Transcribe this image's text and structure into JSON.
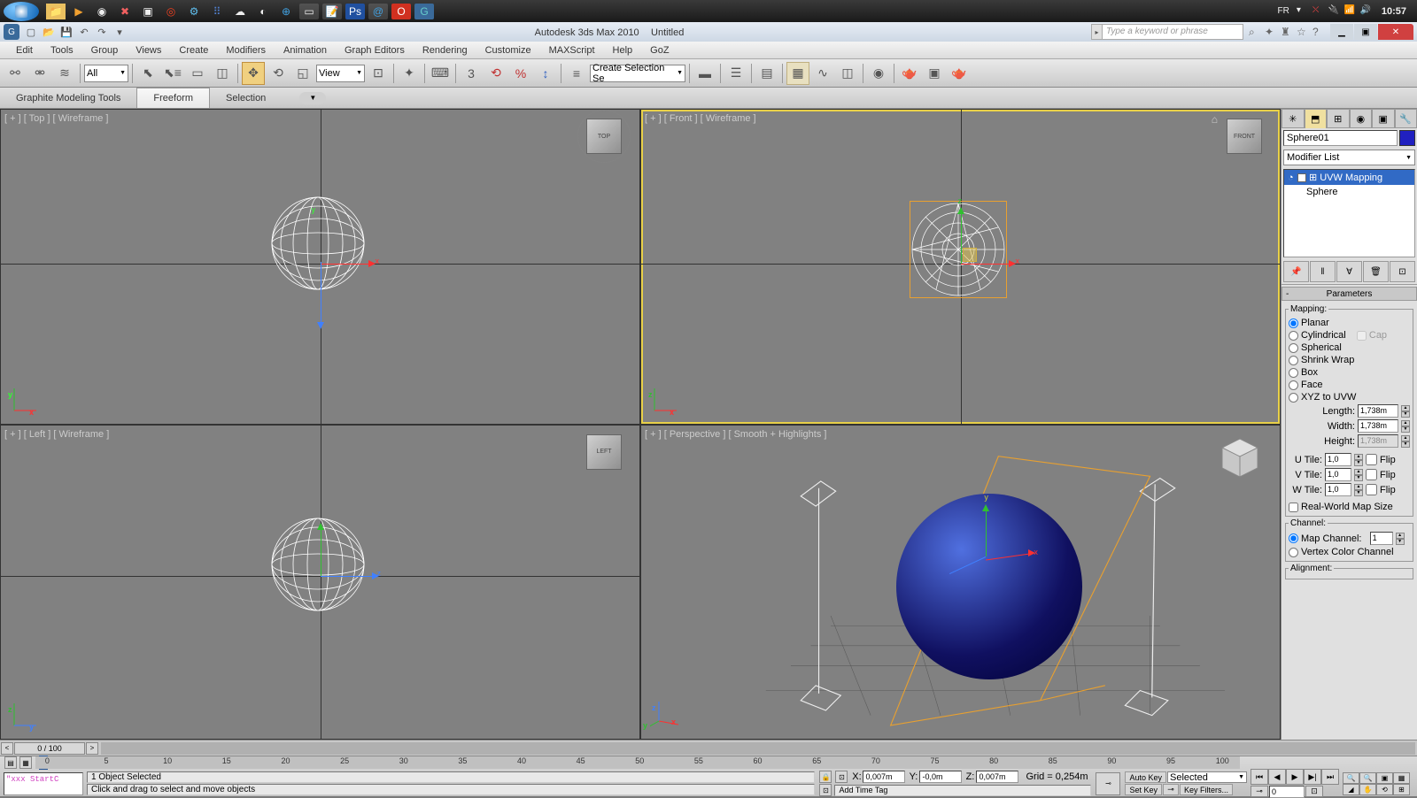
{
  "taskbar": {
    "lang": "FR",
    "clock": "10:57"
  },
  "title": {
    "app": "Autodesk 3ds Max  2010",
    "doc": "Untitled",
    "search_placeholder": "Type a keyword or phrase"
  },
  "menu": [
    "Edit",
    "Tools",
    "Group",
    "Views",
    "Create",
    "Modifiers",
    "Animation",
    "Graph Editors",
    "Rendering",
    "Customize",
    "MAXScript",
    "Help",
    "GoZ"
  ],
  "toolbar": {
    "filter": "All",
    "view_label": "View",
    "create_sel": "Create Selection Se"
  },
  "ribbon": {
    "tabs": [
      "Graphite Modeling Tools",
      "Freeform",
      "Selection"
    ],
    "active": 1
  },
  "viewports": {
    "labels": [
      "[ + ] [ Top ] [ Wireframe ]",
      "[ + ] [ Front ] [ Wireframe ]",
      "[ + ] [ Left ] [ Wireframe ]",
      "[ + ] [ Perspective ] [ Smooth + Highlights ]"
    ],
    "cubes": [
      "TOP",
      "FRONT",
      "LEFT",
      ""
    ]
  },
  "cmdpanel": {
    "object_name": "Sphere01",
    "modifier_list": "Modifier List",
    "modifiers": [
      "UVW Mapping",
      "Sphere"
    ],
    "rollout_params": "Parameters",
    "mapping_label": "Mapping:",
    "mappings": [
      "Planar",
      "Cylindrical",
      "Spherical",
      "Shrink Wrap",
      "Box",
      "Face",
      "XYZ to UVW"
    ],
    "cap_label": "Cap",
    "length_label": "Length:",
    "length_val": "1,738m",
    "width_label": "Width:",
    "width_val": "1,738m",
    "height_label": "Height:",
    "height_val": "1,738m",
    "utile_label": "U Tile:",
    "utile_val": "1,0",
    "vtile_label": "V Tile:",
    "vtile_val": "1,0",
    "wtile_label": "W Tile:",
    "wtile_val": "1,0",
    "flip_label": "Flip",
    "realworld_label": "Real-World Map Size",
    "channel_label": "Channel:",
    "mapchan_label": "Map Channel:",
    "mapchan_val": "1",
    "vertexcolor_label": "Vertex Color Channel",
    "alignment_label": "Alignment:"
  },
  "timeslider": {
    "pos": "0 / 100",
    "ticks": [
      "0",
      "5",
      "10",
      "15",
      "20",
      "25",
      "30",
      "35",
      "40",
      "45",
      "50",
      "55",
      "60",
      "65",
      "70",
      "75",
      "80",
      "85",
      "90",
      "95",
      "100"
    ]
  },
  "status": {
    "maxscript": "\"xxx StartC",
    "sel_info": "1 Object Selected",
    "prompt": "Click and drag to select and move objects",
    "x": "0,007m",
    "y": "-0,0m",
    "z": "0,007m",
    "grid": "Grid = 0,254m",
    "autokey": "Auto Key",
    "setkey": "Set Key",
    "selected": "Selected",
    "keyfilters": "Key Filters...",
    "addtimetag": "Add Time Tag",
    "time": "0"
  }
}
